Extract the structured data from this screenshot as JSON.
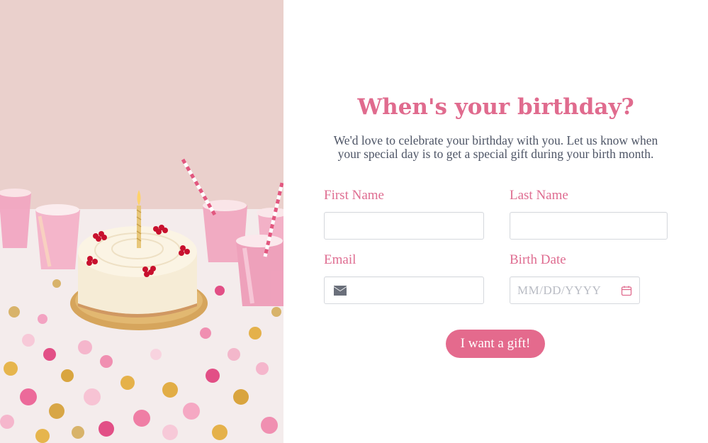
{
  "form": {
    "title": "When's your birthday?",
    "subtitle": "We'd love to celebrate your birthday with you. Let us know when your special day is to get a special gift during your birth month.",
    "first_name_label": "First Name",
    "first_name_value": "",
    "last_name_label": "Last Name",
    "last_name_value": "",
    "email_label": "Email",
    "email_value": "",
    "birth_date_label": "Birth Date",
    "birth_date_placeholder": "MM/DD/YYYY",
    "submit_label": "I want a gift!"
  },
  "icons": {
    "email": "mail-icon",
    "birth_date": "calendar-icon"
  },
  "colors": {
    "accent": "#e06b8e",
    "button": "#e46a8d",
    "body_text": "#4e5566",
    "field_border": "#d6d9de",
    "placeholder": "#b9bcc4"
  },
  "image": {
    "subject": "birthday cake with candle, party cups and confetti"
  }
}
